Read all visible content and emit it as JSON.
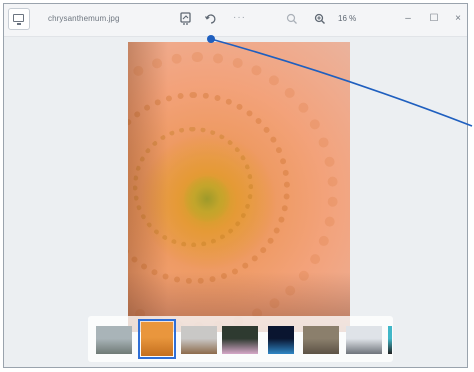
{
  "window": {
    "file_name": "chrysanthemum.jpg",
    "zoom": "16 %",
    "more": "···",
    "controls": {
      "minimize": "–",
      "maximize": "☐",
      "close": "×"
    }
  },
  "toolbar": {
    "icons": [
      "edit-image-icon",
      "rotate-icon",
      "more-icon",
      "zoom-out-icon",
      "zoom-in-icon"
    ]
  },
  "main_image": {
    "subject": "orange-chrysanthemum-icon"
  },
  "filmstrip": {
    "thumbnails": [
      {
        "name": "thumb-misty-landscape",
        "colors": [
          "#a9b4b8",
          "#6f7a76"
        ],
        "selected": false
      },
      {
        "name": "thumb-chrysanthemum",
        "colors": [
          "#e9963d",
          "#c4701f"
        ],
        "selected": true
      },
      {
        "name": "thumb-desert",
        "colors": [
          "#c9c8c6",
          "#8c6a4b"
        ],
        "selected": false
      },
      {
        "name": "thumb-hydrangea",
        "colors": [
          "#2e3a30",
          "#d6a8c8"
        ],
        "selected": false
      },
      {
        "name": "thumb-jellyfish",
        "colors": [
          "#0a1530",
          "#2f86c4"
        ],
        "selected": false
      },
      {
        "name": "thumb-koala",
        "colors": [
          "#8b7f6c",
          "#5c5245"
        ],
        "selected": false
      },
      {
        "name": "thumb-lighthouse",
        "colors": [
          "#dfe3e8",
          "#6f747b"
        ],
        "selected": false
      },
      {
        "name": "thumb-penguins",
        "colors": [
          "#41b7c8",
          "#222222"
        ],
        "selected": false
      }
    ]
  },
  "colors": {
    "accent": "#2f6fd6",
    "callout": "#1f5fbf"
  }
}
